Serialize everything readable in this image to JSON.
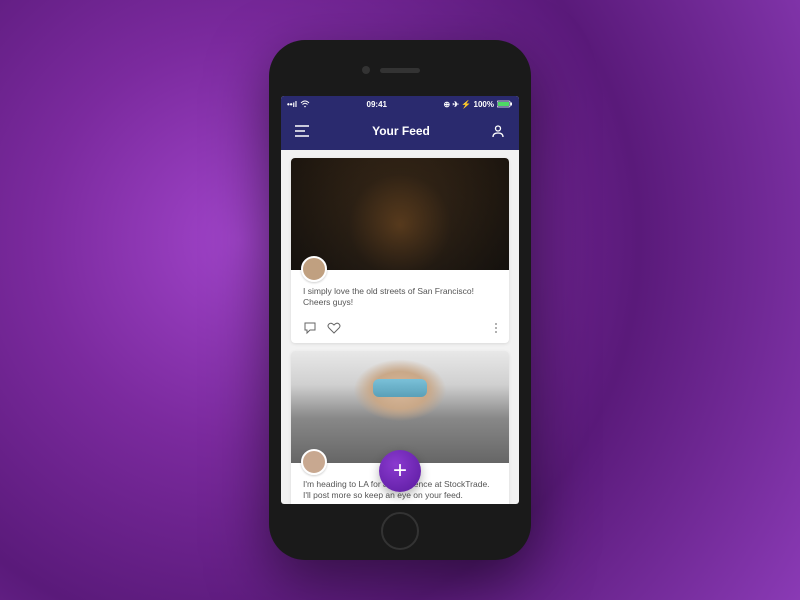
{
  "status": {
    "signal": "••ıl",
    "wifi": "wifi",
    "time": "09:41",
    "indicators": "⊕ ✈ ⚡ 100%",
    "battery": "battery"
  },
  "nav": {
    "menu_icon": "menu-icon",
    "title": "Your Feed",
    "profile_icon": "profile-icon"
  },
  "posts": [
    {
      "text": "I simply love the old streets of San Francisco! Cheers guys!",
      "image": "street",
      "avatar_color": "#b89070"
    },
    {
      "text": "I'm heading to LA for a conference at StockTrade. I'll post more so keep an eye on your feed.",
      "image": "selfie",
      "avatar_color": "#c8a890"
    }
  ],
  "fab": {
    "label": "+"
  },
  "icons": {
    "comment": "comment-icon",
    "like": "heart-icon",
    "more": "more-icon"
  }
}
